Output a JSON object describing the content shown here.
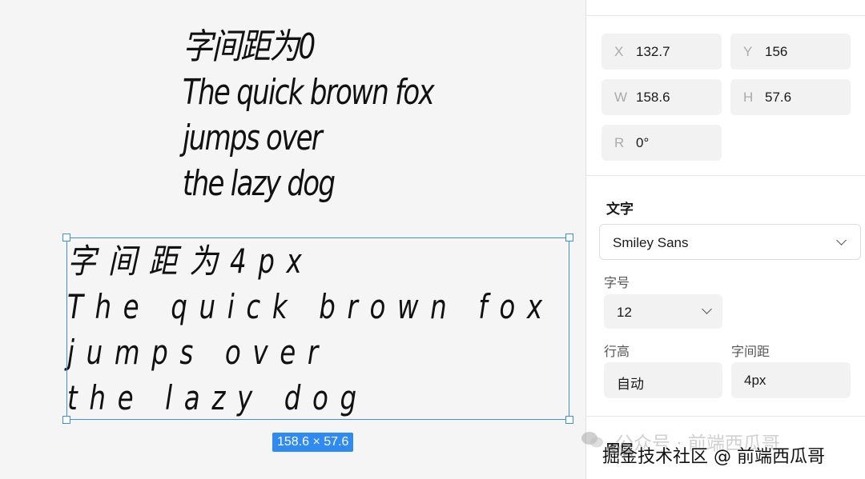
{
  "canvas": {
    "text1_lines": [
      "字间距为0",
      "The quick brown fox",
      "jumps over",
      "the lazy dog"
    ],
    "text2_lines": [
      "字间距为4px",
      "The quick brown fox",
      "jumps over",
      "the lazy dog"
    ],
    "dimension_badge": "158.6 × 57.6"
  },
  "panel": {
    "x": {
      "label": "X",
      "value": "132.7"
    },
    "y": {
      "label": "Y",
      "value": "156"
    },
    "w": {
      "label": "W",
      "value": "158.6"
    },
    "h": {
      "label": "H",
      "value": "57.6"
    },
    "r": {
      "label": "R",
      "value": "0°"
    },
    "text_section_title": "文字",
    "font_family": "Smiley Sans",
    "font_size_label": "字号",
    "font_size": "12",
    "line_height_label": "行高",
    "line_height": "自动",
    "letter_spacing_label": "字间距",
    "letter_spacing": "4px",
    "next_section_title": "图层"
  },
  "watermarks": {
    "wechat": "公众号 · 前端西瓜哥",
    "juejin": "掘金技术社区 @ 前端西瓜哥"
  },
  "colors": {
    "selection": "#3b8ff0",
    "badge": "#2f8af2",
    "canvas_bg": "#f5f5f5",
    "panel_bg": "#ffffff"
  }
}
